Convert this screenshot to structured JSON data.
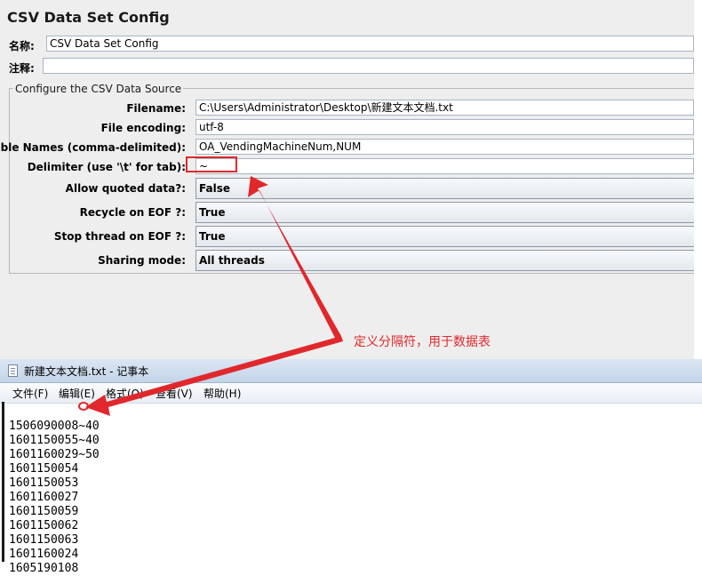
{
  "config": {
    "title": "CSV Data Set Config",
    "name_label": "名称:",
    "name_value": "CSV Data Set Config",
    "comment_label": "注释:",
    "comment_value": "",
    "group_title": "Configure the CSV Data Source",
    "filename_label": "Filename:",
    "filename_value": "C:\\Users\\Administrator\\Desktop\\新建文本文档.txt",
    "encoding_label": "File encoding:",
    "encoding_value": "utf-8",
    "varnames_label": "Variable Names (comma-delimited):",
    "varnames_value": "OA_VendingMachineNum,NUM",
    "delimiter_label": "Delimiter (use '\\t' for tab):",
    "delimiter_value": "~",
    "quoted_label": "Allow quoted data?:",
    "quoted_value": "False",
    "recycle_label": "Recycle on EOF ?:",
    "recycle_value": "True",
    "stopthread_label": "Stop thread on EOF ?:",
    "stopthread_value": "True",
    "sharing_label": "Sharing mode:",
    "sharing_value": "All threads"
  },
  "annotation": {
    "text": "定义分隔符，用于数据表",
    "color": "#e0282c"
  },
  "notepad": {
    "title": "新建文本文档.txt - 记事本",
    "menus": [
      "文件(F)",
      "编辑(E)",
      "格式(O)",
      "查看(V)",
      "帮助(H)"
    ],
    "lines": [
      "1506090008~40",
      "1601150055~40",
      "1601160029~50",
      "1601150054",
      "1601150053",
      "1601160027",
      "1601150059",
      "1601150062",
      "1601150063",
      "1601160024",
      "1605190108"
    ]
  }
}
